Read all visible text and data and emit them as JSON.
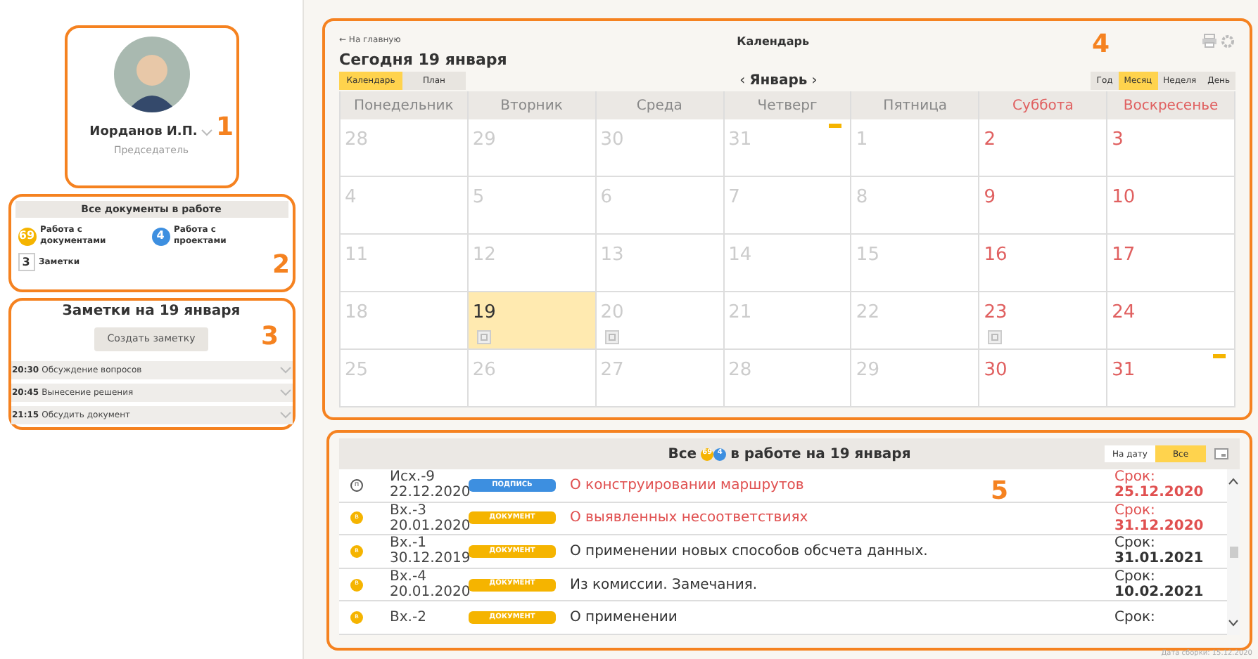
{
  "profile": {
    "name": "Иорданов И.П.",
    "role": "Председатель",
    "callout": "1"
  },
  "docs_summary": {
    "title": "Все документы в работе",
    "callout": "2",
    "items": [
      {
        "kind": "circle",
        "count": "69",
        "label": "Работа с документами",
        "color": "#f5b400"
      },
      {
        "kind": "circle",
        "count": "4",
        "label": "Работа с проектами",
        "color": "#3d8fe0"
      },
      {
        "kind": "square",
        "count": "3",
        "label": "Заметки",
        "color": "#333333"
      }
    ]
  },
  "notes": {
    "title": "Заметки на 19 января",
    "button": "Создать заметку",
    "callout": "3",
    "items": [
      {
        "time": "20:30",
        "text": "Обсуждение вопросов",
        "expanded": false
      },
      {
        "time": "20:45",
        "text": "Вынесение решения",
        "expanded": false
      },
      {
        "time": "21:15",
        "text": "Обсудить документ",
        "expanded": false
      }
    ]
  },
  "calendar": {
    "back_link": "← На главную",
    "title": "Календарь",
    "today": "Сегодня 19 января",
    "callout": "4",
    "month": "Январь",
    "prev": "‹",
    "next": "›",
    "modes": [
      {
        "label": "Календарь",
        "selected": true
      },
      {
        "label": "План",
        "selected": false
      }
    ],
    "views": [
      {
        "label": "Год",
        "selected": false
      },
      {
        "label": "Месяц",
        "selected": true
      },
      {
        "label": "Неделя",
        "selected": false
      },
      {
        "label": "День",
        "selected": false
      }
    ],
    "weekdays": [
      {
        "label": "Понедельник",
        "weekend": false
      },
      {
        "label": "Вторник",
        "weekend": false
      },
      {
        "label": "Среда",
        "weekend": false
      },
      {
        "label": "Четверг",
        "weekend": false
      },
      {
        "label": "Пятница",
        "weekend": false
      },
      {
        "label": "Суббота",
        "weekend": true
      },
      {
        "label": "Воскресенье",
        "weekend": true
      }
    ],
    "weeks": [
      [
        {
          "day": "28",
          "selected": false,
          "note": false,
          "marker": false
        },
        {
          "day": "29",
          "selected": false,
          "note": false,
          "marker": false
        },
        {
          "day": "30",
          "selected": false,
          "note": false,
          "marker": false
        },
        {
          "day": "31",
          "selected": false,
          "note": false,
          "marker": true
        },
        {
          "day": "1",
          "selected": false,
          "note": false,
          "marker": false
        },
        {
          "day": "2",
          "selected": false,
          "note": false,
          "marker": false
        },
        {
          "day": "3",
          "selected": false,
          "note": false,
          "marker": false
        }
      ],
      [
        {
          "day": "4",
          "selected": false,
          "note": false,
          "marker": false
        },
        {
          "day": "5",
          "selected": false,
          "note": false,
          "marker": false
        },
        {
          "day": "6",
          "selected": false,
          "note": false,
          "marker": false
        },
        {
          "day": "7",
          "selected": false,
          "note": false,
          "marker": false
        },
        {
          "day": "8",
          "selected": false,
          "note": false,
          "marker": false
        },
        {
          "day": "9",
          "selected": false,
          "note": false,
          "marker": false
        },
        {
          "day": "10",
          "selected": false,
          "note": false,
          "marker": false
        }
      ],
      [
        {
          "day": "11",
          "selected": false,
          "note": false,
          "marker": false
        },
        {
          "day": "12",
          "selected": false,
          "note": false,
          "marker": false
        },
        {
          "day": "13",
          "selected": false,
          "note": false,
          "marker": false
        },
        {
          "day": "14",
          "selected": false,
          "note": false,
          "marker": false
        },
        {
          "day": "15",
          "selected": false,
          "note": false,
          "marker": false
        },
        {
          "day": "16",
          "selected": false,
          "note": false,
          "marker": false
        },
        {
          "day": "17",
          "selected": false,
          "note": false,
          "marker": false
        }
      ],
      [
        {
          "day": "18",
          "selected": false,
          "note": false,
          "marker": false
        },
        {
          "day": "19",
          "selected": true,
          "note": true,
          "marker": false
        },
        {
          "day": "20",
          "selected": false,
          "note": true,
          "marker": false
        },
        {
          "day": "21",
          "selected": false,
          "note": false,
          "marker": false
        },
        {
          "day": "22",
          "selected": false,
          "note": false,
          "marker": false
        },
        {
          "day": "23",
          "selected": false,
          "note": true,
          "marker": false
        },
        {
          "day": "24",
          "selected": false,
          "note": false,
          "marker": false
        }
      ],
      [
        {
          "day": "25",
          "selected": false,
          "note": false,
          "marker": false
        },
        {
          "day": "26",
          "selected": false,
          "note": false,
          "marker": false
        },
        {
          "day": "27",
          "selected": false,
          "note": false,
          "marker": false
        },
        {
          "day": "28",
          "selected": false,
          "note": false,
          "marker": false
        },
        {
          "day": "29",
          "selected": false,
          "note": false,
          "marker": false
        },
        {
          "day": "30",
          "selected": false,
          "note": false,
          "marker": false
        },
        {
          "day": "31",
          "selected": false,
          "note": false,
          "marker": true
        }
      ]
    ]
  },
  "documents": {
    "title_start": "Все",
    "badges": [
      {
        "count": "69",
        "color": "#f5b400"
      },
      {
        "count": "4",
        "color": "#3d8fe0"
      }
    ],
    "title_end": "в работе на 19 января",
    "callout": "5",
    "filters": [
      {
        "label": "На дату",
        "selected": false
      },
      {
        "label": "Все",
        "selected": true
      }
    ],
    "rows": [
      {
        "kind": "outline",
        "letter": "п",
        "number": "Исх.-9",
        "date": "22.12.2020",
        "tag": "ПОДПИСЬ",
        "title": "О конструировании маршрутов",
        "overdue": true,
        "due_label": "Срок:",
        "due": "25.12.2020"
      },
      {
        "kind": "filled",
        "letter": "в",
        "number": "Вх.-3",
        "date": "20.01.2020",
        "tag": "ДОКУМЕНТ",
        "title": "О выявленных несоответствиях",
        "overdue": true,
        "due_label": "Срок:",
        "due": "31.12.2020"
      },
      {
        "kind": "filled",
        "letter": "в",
        "number": "Вх.-1",
        "date": "30.12.2019",
        "tag": "ДОКУМЕНТ",
        "title": "О применении новых способов обсчета данных.",
        "overdue": false,
        "due_label": "Срок:",
        "due": "31.01.2021"
      },
      {
        "kind": "filled",
        "letter": "в",
        "number": "Вх.-4",
        "date": "20.01.2020",
        "tag": "ДОКУМЕНТ",
        "title": "Из комиссии. Замечания.",
        "overdue": false,
        "due_label": "Срок:",
        "due": "10.02.2021"
      },
      {
        "kind": "filled",
        "letter": "в",
        "number": "Вх.-2",
        "date": "",
        "tag": "ДОКУМЕНТ",
        "title": "О применении",
        "overdue": false,
        "due_label": "Срок:",
        "due": ""
      }
    ]
  },
  "footer": "Дата сборки: 15.12.2020"
}
